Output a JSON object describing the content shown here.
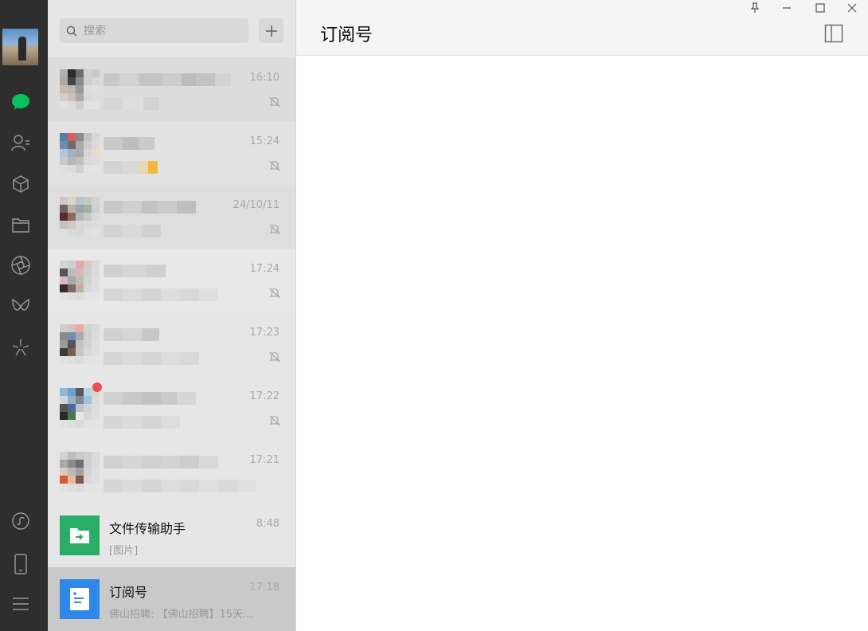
{
  "window": {
    "title": "订阅号",
    "controls": [
      "pin",
      "minimize",
      "maximize",
      "close"
    ]
  },
  "rail": {
    "icons": [
      "chat-icon",
      "contacts-icon",
      "favorites-icon",
      "files-icon",
      "moments-icon",
      "channels-icon",
      "discover-icon",
      "mini-programs-icon",
      "phone-icon",
      "menu-icon"
    ],
    "accent_color": "#07c160"
  },
  "search": {
    "placeholder": "搜索"
  },
  "chats": [
    {
      "name": "",
      "message": "",
      "time": "16:10",
      "muted": true,
      "blurred": true
    },
    {
      "name": "",
      "message": "",
      "time": "15:24",
      "muted": true,
      "blurred": true
    },
    {
      "name": "",
      "message": "",
      "time": "24/10/11",
      "muted": true,
      "blurred": true
    },
    {
      "name": "",
      "message": "",
      "time": "17:24",
      "muted": true,
      "blurred": true
    },
    {
      "name": "",
      "message": "",
      "time": "17:23",
      "muted": true,
      "blurred": true
    },
    {
      "name": "",
      "message": "",
      "time": "17:22",
      "muted": true,
      "blurred": true,
      "unread": true
    },
    {
      "name": "",
      "message": "",
      "time": "17:21",
      "muted": false,
      "blurred": true
    },
    {
      "name": "文件传输助手",
      "message": "[图片]",
      "time": "8:48",
      "muted": false,
      "blurred": false
    },
    {
      "name": "订阅号",
      "message": "佛山招聘: 【佛山招聘】15天...",
      "time": "17:18",
      "muted": false,
      "blurred": false,
      "selected": true
    }
  ]
}
